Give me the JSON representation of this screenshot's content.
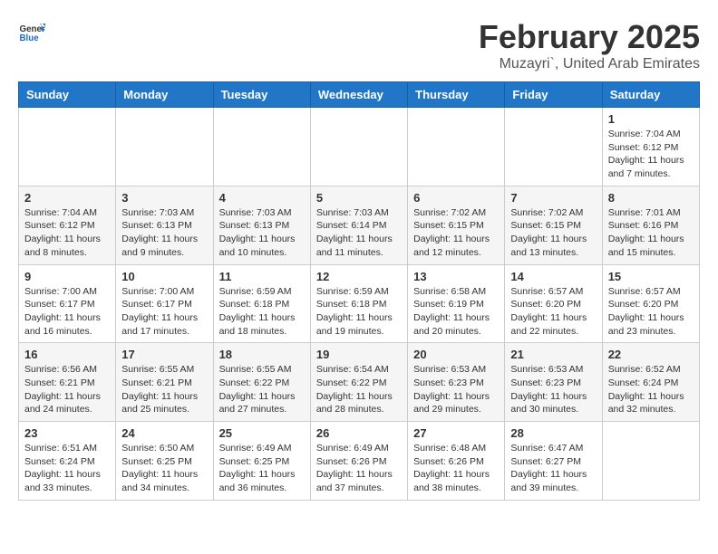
{
  "header": {
    "logo_general": "General",
    "logo_blue": "Blue",
    "month_year": "February 2025",
    "location": "Muzayri`, United Arab Emirates"
  },
  "weekdays": [
    "Sunday",
    "Monday",
    "Tuesday",
    "Wednesday",
    "Thursday",
    "Friday",
    "Saturday"
  ],
  "weeks": [
    [
      {
        "day": "",
        "info": ""
      },
      {
        "day": "",
        "info": ""
      },
      {
        "day": "",
        "info": ""
      },
      {
        "day": "",
        "info": ""
      },
      {
        "day": "",
        "info": ""
      },
      {
        "day": "",
        "info": ""
      },
      {
        "day": "1",
        "info": "Sunrise: 7:04 AM\nSunset: 6:12 PM\nDaylight: 11 hours and 7 minutes."
      }
    ],
    [
      {
        "day": "2",
        "info": "Sunrise: 7:04 AM\nSunset: 6:12 PM\nDaylight: 11 hours and 8 minutes."
      },
      {
        "day": "3",
        "info": "Sunrise: 7:03 AM\nSunset: 6:13 PM\nDaylight: 11 hours and 9 minutes."
      },
      {
        "day": "4",
        "info": "Sunrise: 7:03 AM\nSunset: 6:13 PM\nDaylight: 11 hours and 10 minutes."
      },
      {
        "day": "5",
        "info": "Sunrise: 7:03 AM\nSunset: 6:14 PM\nDaylight: 11 hours and 11 minutes."
      },
      {
        "day": "6",
        "info": "Sunrise: 7:02 AM\nSunset: 6:15 PM\nDaylight: 11 hours and 12 minutes."
      },
      {
        "day": "7",
        "info": "Sunrise: 7:02 AM\nSunset: 6:15 PM\nDaylight: 11 hours and 13 minutes."
      },
      {
        "day": "8",
        "info": "Sunrise: 7:01 AM\nSunset: 6:16 PM\nDaylight: 11 hours and 15 minutes."
      }
    ],
    [
      {
        "day": "9",
        "info": "Sunrise: 7:00 AM\nSunset: 6:17 PM\nDaylight: 11 hours and 16 minutes."
      },
      {
        "day": "10",
        "info": "Sunrise: 7:00 AM\nSunset: 6:17 PM\nDaylight: 11 hours and 17 minutes."
      },
      {
        "day": "11",
        "info": "Sunrise: 6:59 AM\nSunset: 6:18 PM\nDaylight: 11 hours and 18 minutes."
      },
      {
        "day": "12",
        "info": "Sunrise: 6:59 AM\nSunset: 6:18 PM\nDaylight: 11 hours and 19 minutes."
      },
      {
        "day": "13",
        "info": "Sunrise: 6:58 AM\nSunset: 6:19 PM\nDaylight: 11 hours and 20 minutes."
      },
      {
        "day": "14",
        "info": "Sunrise: 6:57 AM\nSunset: 6:20 PM\nDaylight: 11 hours and 22 minutes."
      },
      {
        "day": "15",
        "info": "Sunrise: 6:57 AM\nSunset: 6:20 PM\nDaylight: 11 hours and 23 minutes."
      }
    ],
    [
      {
        "day": "16",
        "info": "Sunrise: 6:56 AM\nSunset: 6:21 PM\nDaylight: 11 hours and 24 minutes."
      },
      {
        "day": "17",
        "info": "Sunrise: 6:55 AM\nSunset: 6:21 PM\nDaylight: 11 hours and 25 minutes."
      },
      {
        "day": "18",
        "info": "Sunrise: 6:55 AM\nSunset: 6:22 PM\nDaylight: 11 hours and 27 minutes."
      },
      {
        "day": "19",
        "info": "Sunrise: 6:54 AM\nSunset: 6:22 PM\nDaylight: 11 hours and 28 minutes."
      },
      {
        "day": "20",
        "info": "Sunrise: 6:53 AM\nSunset: 6:23 PM\nDaylight: 11 hours and 29 minutes."
      },
      {
        "day": "21",
        "info": "Sunrise: 6:53 AM\nSunset: 6:23 PM\nDaylight: 11 hours and 30 minutes."
      },
      {
        "day": "22",
        "info": "Sunrise: 6:52 AM\nSunset: 6:24 PM\nDaylight: 11 hours and 32 minutes."
      }
    ],
    [
      {
        "day": "23",
        "info": "Sunrise: 6:51 AM\nSunset: 6:24 PM\nDaylight: 11 hours and 33 minutes."
      },
      {
        "day": "24",
        "info": "Sunrise: 6:50 AM\nSunset: 6:25 PM\nDaylight: 11 hours and 34 minutes."
      },
      {
        "day": "25",
        "info": "Sunrise: 6:49 AM\nSunset: 6:25 PM\nDaylight: 11 hours and 36 minutes."
      },
      {
        "day": "26",
        "info": "Sunrise: 6:49 AM\nSunset: 6:26 PM\nDaylight: 11 hours and 37 minutes."
      },
      {
        "day": "27",
        "info": "Sunrise: 6:48 AM\nSunset: 6:26 PM\nDaylight: 11 hours and 38 minutes."
      },
      {
        "day": "28",
        "info": "Sunrise: 6:47 AM\nSunset: 6:27 PM\nDaylight: 11 hours and 39 minutes."
      },
      {
        "day": "",
        "info": ""
      }
    ]
  ]
}
